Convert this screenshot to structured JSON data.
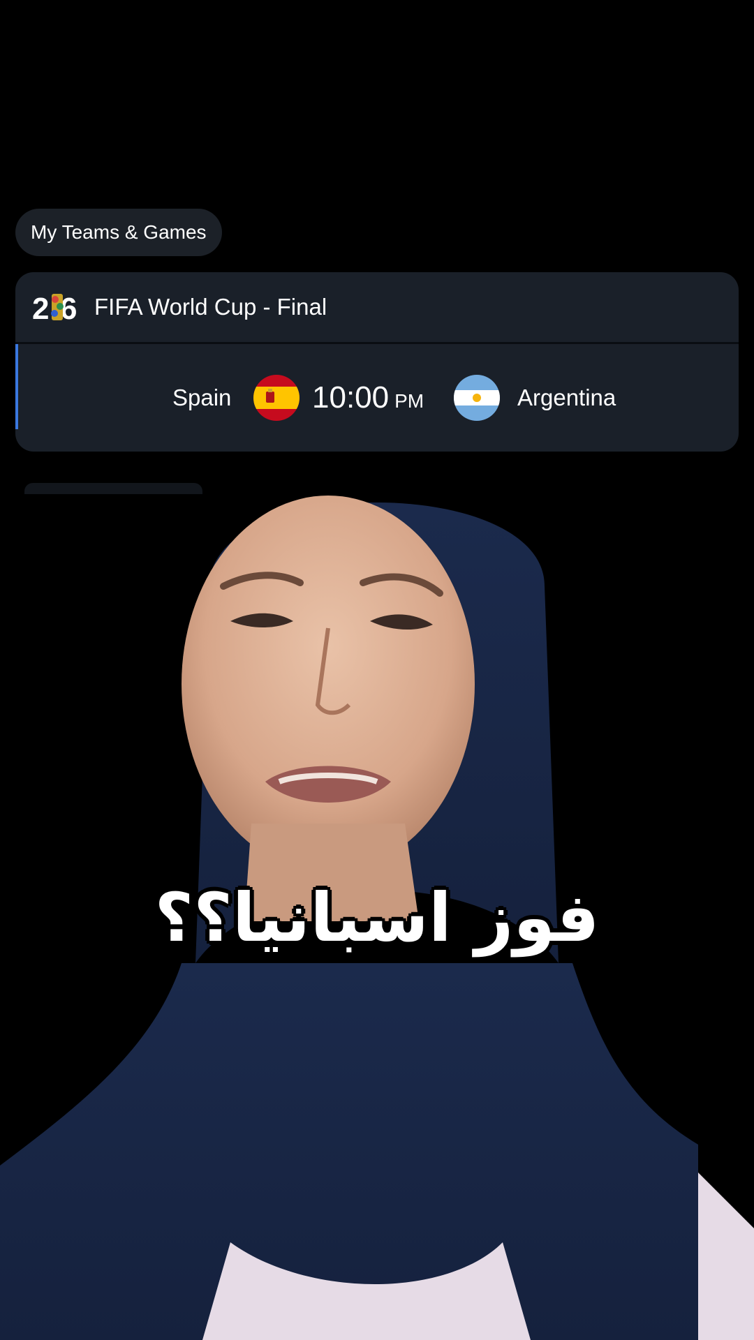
{
  "section_chip": {
    "label": "My Teams & Games"
  },
  "match_card": {
    "title": "FIFA World Cup - Final",
    "logo_icon": "world-cup-26-logo-icon",
    "home_team": {
      "name": "Spain",
      "flag_icon": "spain-flag-icon"
    },
    "away_team": {
      "name": "Argentina",
      "flag_icon": "argentina-flag-icon"
    },
    "kickoff": {
      "time": "10:00",
      "period": "PM"
    }
  },
  "video": {
    "caption": "فوز اسبانيا؟؟"
  },
  "colors": {
    "background": "#000000",
    "card_background": "#1a2029",
    "chip_background": "#1c2128",
    "accent": "#3a78e0",
    "text": "#ffffff"
  }
}
